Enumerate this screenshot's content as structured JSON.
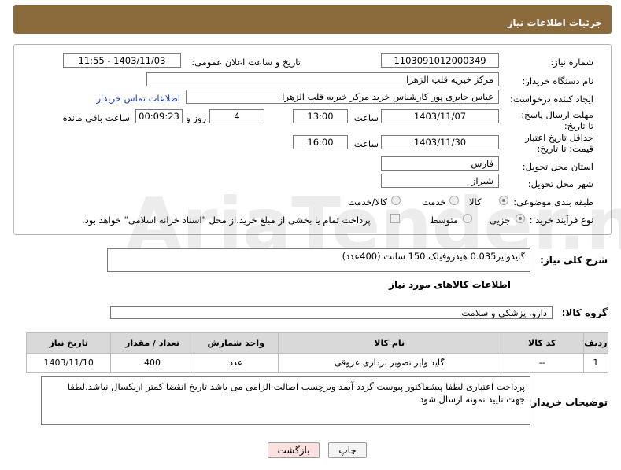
{
  "header": {
    "title": "جزئیات اطلاعات نیاز"
  },
  "form": {
    "need_number_label": "شماره نیاز:",
    "need_number": "1103091012000349",
    "announce_label": "تاریخ و ساعت اعلان عمومی:",
    "announce_value": "1403/11/03 - 11:55",
    "buyer_org_label": "نام دستگاه خریدار:",
    "buyer_org": "مرکز خیریه قلب الزهرا",
    "requester_label": "ایجاد کننده درخواست:",
    "requester": "عباس جابری پور کارشناس خرید مرکز خیریه قلب الزهرا",
    "contact_link": "اطلاعات تماس خریدار",
    "reply_deadline_label": "مهلت ارسال پاسخ: تا تاریخ:",
    "reply_date": "1403/11/07",
    "time_label": "ساعت",
    "reply_time": "13:00",
    "days_value": "4",
    "days_label": "روز و",
    "remaining_time": "00:09:23",
    "remaining_label": "ساعت باقی مانده",
    "price_deadline_label": "حداقل تاریخ اعتبار قیمت: تا تاریخ:",
    "price_date": "1403/11/30",
    "price_time": "16:00",
    "province_label": "استان محل تحویل:",
    "province": "فارس",
    "city_label": "شهر محل تحویل:",
    "city": "شیراز",
    "category_label": "طبقه بندی موضوعی:",
    "category_options": [
      "کالا",
      "خدمت",
      "کالا/خدمت"
    ],
    "process_label": "نوع فرآیند خرید :",
    "process_options": [
      "جزیی",
      "متوسط"
    ],
    "payment_note": "پرداخت تمام یا بخشی از مبلغ خرید،از محل \"اسناد خزانه اسلامی\" خواهد بود."
  },
  "summary": {
    "label": "شرح کلی نیاز:",
    "value": "گایدوایر0.035 هیدروفیلک 150 سانت (400عدد)"
  },
  "goods_section": {
    "title": "اطلاعات کالاهای مورد نیاز"
  },
  "goods_group": {
    "label": "گروه کالا:",
    "value": "دارو، پزشکی و سلامت"
  },
  "table": {
    "headers": [
      "ردیف",
      "کد کالا",
      "نام کالا",
      "واحد شمارش",
      "تعداد / مقدار",
      "تاریخ نیاز"
    ],
    "rows": [
      {
        "index": "1",
        "code": "--",
        "name": "گاید وایر تصویر برداری عروقی",
        "unit": "عدد",
        "qty": "400",
        "date": "1403/11/10"
      }
    ]
  },
  "buyer_notes": {
    "label": "توضیحات خریدار:",
    "value": "پرداخت اعتباری لطفا پیشفاکتور پیوست گردد آیمد وبرچسب اصالت الزامی می باشد تاریخ انقضا کمتر ازیکسال نباشد.لطفا جهت تایید نمونه ارسال شود"
  },
  "buttons": {
    "print": "چاپ",
    "back": "بازگشت"
  },
  "watermark": {
    "text": "AriaTender.net"
  },
  "colors": {
    "header_bg": "#8b6b3c",
    "link": "#1a3ea8",
    "back_button_bg": "#fde0e0"
  }
}
